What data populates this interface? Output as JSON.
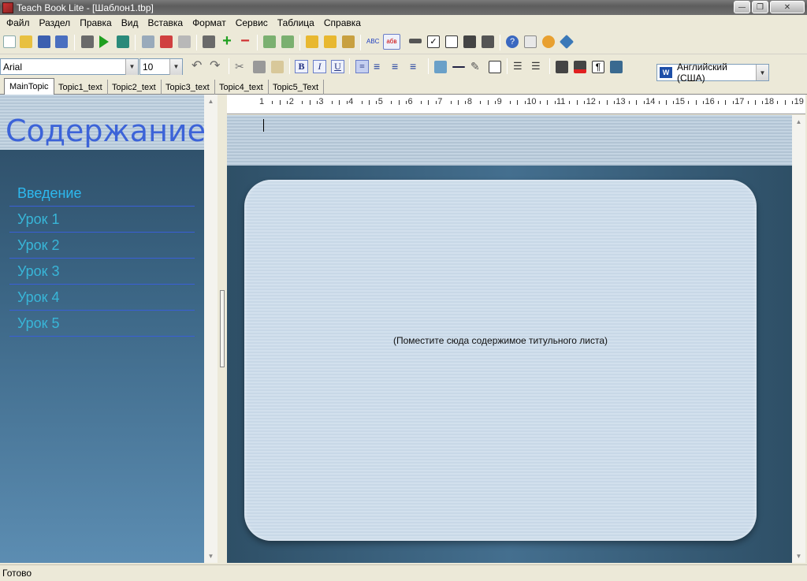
{
  "window": {
    "title": "Teach Book Lite - [Шаблон1.tbp]"
  },
  "menu": [
    "Файл",
    "Раздел",
    "Правка",
    "Вид",
    "Вставка",
    "Формат",
    "Сервис",
    "Таблица",
    "Справка"
  ],
  "toolbar": {
    "language": "Английский (США)",
    "font": "Arial",
    "size": "10",
    "bold": "B",
    "italic": "I",
    "underline": "U"
  },
  "tabs": [
    "MainTopic",
    "Topic1_text",
    "Topic2_text",
    "Topic3_text",
    "Topic4_text",
    "Topic5_Text"
  ],
  "toc": {
    "title": "Содержание:",
    "items": [
      "Введение",
      "Урок 1",
      "Урок 2",
      "Урок 3",
      "Урок 4",
      "Урок 5"
    ]
  },
  "ruler": [
    "1",
    "2",
    "3",
    "4",
    "5",
    "6",
    "7",
    "8",
    "9",
    "10",
    "11",
    "12",
    "13",
    "14",
    "15",
    "16",
    "17",
    "18",
    "19"
  ],
  "document": {
    "placeholder": "(Поместите сюда содержимое титульного листа)"
  },
  "status": {
    "text": "Готово"
  }
}
